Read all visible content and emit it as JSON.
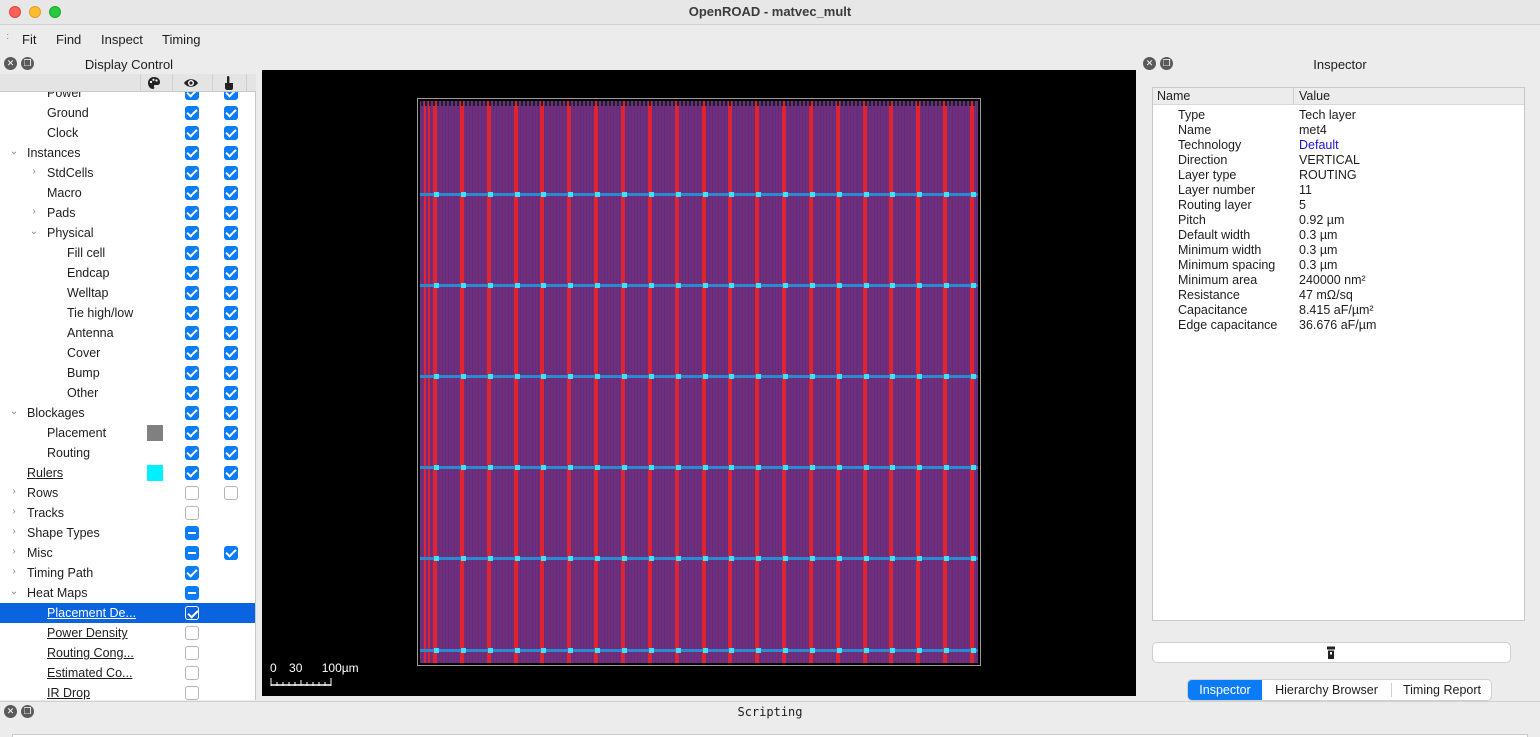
{
  "window": {
    "title": "OpenROAD - matvec_mult"
  },
  "menu": [
    "Fit",
    "Find",
    "Inspect",
    "Timing"
  ],
  "display_control": {
    "title": "Display Control",
    "column_icons": [
      "palette-icon",
      "eye-icon",
      "hand-pointer-icon"
    ],
    "rows": [
      {
        "label": "Power",
        "arrow": "",
        "indent": 2,
        "vis": "on",
        "sel": "on",
        "clip": true
      },
      {
        "label": "Ground",
        "arrow": "",
        "indent": 2,
        "vis": "on",
        "sel": "on"
      },
      {
        "label": "Clock",
        "arrow": "",
        "indent": 2,
        "vis": "on",
        "sel": "on"
      },
      {
        "label": "Instances",
        "arrow": "down",
        "indent": 1,
        "vis": "on",
        "sel": "on"
      },
      {
        "label": "StdCells",
        "arrow": "right",
        "indent": 2,
        "vis": "on",
        "sel": "on"
      },
      {
        "label": "Macro",
        "arrow": "",
        "indent": 2,
        "vis": "on",
        "sel": "on"
      },
      {
        "label": "Pads",
        "arrow": "right",
        "indent": 2,
        "vis": "on",
        "sel": "on"
      },
      {
        "label": "Physical",
        "arrow": "down",
        "indent": 2,
        "vis": "on",
        "sel": "on"
      },
      {
        "label": "Fill cell",
        "arrow": "",
        "indent": 3,
        "vis": "on",
        "sel": "on"
      },
      {
        "label": "Endcap",
        "arrow": "",
        "indent": 3,
        "vis": "on",
        "sel": "on"
      },
      {
        "label": "Welltap",
        "arrow": "",
        "indent": 3,
        "vis": "on",
        "sel": "on"
      },
      {
        "label": "Tie high/low",
        "arrow": "",
        "indent": 3,
        "vis": "on",
        "sel": "on"
      },
      {
        "label": "Antenna",
        "arrow": "",
        "indent": 3,
        "vis": "on",
        "sel": "on"
      },
      {
        "label": "Cover",
        "arrow": "",
        "indent": 3,
        "vis": "on",
        "sel": "on"
      },
      {
        "label": "Bump",
        "arrow": "",
        "indent": 3,
        "vis": "on",
        "sel": "on"
      },
      {
        "label": "Other",
        "arrow": "",
        "indent": 3,
        "vis": "on",
        "sel": "on"
      },
      {
        "label": "Blockages",
        "arrow": "down",
        "indent": 1,
        "vis": "on",
        "sel": "on"
      },
      {
        "label": "Placement",
        "arrow": "",
        "indent": 2,
        "vis": "on",
        "sel": "on",
        "color": "#808080"
      },
      {
        "label": "Routing",
        "arrow": "",
        "indent": 2,
        "vis": "on",
        "sel": "on"
      },
      {
        "label": "Rulers",
        "arrow": "",
        "indent": 1,
        "vis": "on",
        "sel": "on",
        "color": "#00f0ff",
        "underline": true
      },
      {
        "label": "Rows",
        "arrow": "right",
        "indent": 1,
        "vis": "off",
        "sel": "off"
      },
      {
        "label": "Tracks",
        "arrow": "right",
        "indent": 1,
        "vis": "off",
        "sel": ""
      },
      {
        "label": "Shape Types",
        "arrow": "right",
        "indent": 1,
        "vis": "part",
        "sel": ""
      },
      {
        "label": "Misc",
        "arrow": "right",
        "indent": 1,
        "vis": "part",
        "sel": "on"
      },
      {
        "label": "Timing Path",
        "arrow": "right",
        "indent": 1,
        "vis": "on",
        "sel": ""
      },
      {
        "label": "Heat Maps",
        "arrow": "down",
        "indent": 1,
        "vis": "part",
        "sel": ""
      },
      {
        "label": "Placement De...",
        "arrow": "",
        "indent": 2,
        "vis": "on",
        "sel": "",
        "underline": true,
        "selected": true
      },
      {
        "label": "Power Density",
        "arrow": "",
        "indent": 2,
        "vis": "off",
        "sel": "",
        "underline": true
      },
      {
        "label": "Routing Cong...",
        "arrow": "",
        "indent": 2,
        "vis": "off",
        "sel": "",
        "underline": true
      },
      {
        "label": "Estimated Co...",
        "arrow": "",
        "indent": 2,
        "vis": "off",
        "sel": "",
        "underline": true
      },
      {
        "label": "IR Drop",
        "arrow": "",
        "indent": 2,
        "vis": "off",
        "sel": "",
        "underline": true
      }
    ]
  },
  "viewer": {
    "scale_bar": {
      "labels": [
        "0",
        "30",
        "100µm"
      ]
    },
    "colors": {
      "background": "#000000",
      "metal": "#6a2a7a",
      "stripe": "#e0242f",
      "strap": "#2a8ad0",
      "via": "#40e0ff"
    }
  },
  "inspector": {
    "title": "Inspector",
    "columns": [
      "Name",
      "Value"
    ],
    "properties": [
      {
        "name": "Type",
        "value": "Tech layer"
      },
      {
        "name": "Name",
        "value": "met4"
      },
      {
        "name": "Technology",
        "value": "Default",
        "link": true
      },
      {
        "name": "Direction",
        "value": "VERTICAL"
      },
      {
        "name": "Layer type",
        "value": "ROUTING"
      },
      {
        "name": "Layer number",
        "value": "11"
      },
      {
        "name": "Routing layer",
        "value": "5"
      },
      {
        "name": "Pitch",
        "value": "0.92 µm"
      },
      {
        "name": "Default width",
        "value": "0.3 µm"
      },
      {
        "name": "Minimum width",
        "value": "0.3 µm"
      },
      {
        "name": "Minimum spacing",
        "value": "0.3 µm"
      },
      {
        "name": "Minimum area",
        "value": "240000 nm²"
      },
      {
        "name": "Resistance",
        "value": "47 mΩ/sq"
      },
      {
        "name": "Capacitance",
        "value": "8.415 aF/µm²"
      },
      {
        "name": "Edge capacitance",
        "value": "36.676 aF/µm"
      }
    ],
    "action_icon": "flashlight-icon",
    "tabs": [
      "Inspector",
      "Hierarchy Browser",
      "Timing Report"
    ],
    "active_tab": 0
  },
  "scripting": {
    "title": "Scripting"
  }
}
